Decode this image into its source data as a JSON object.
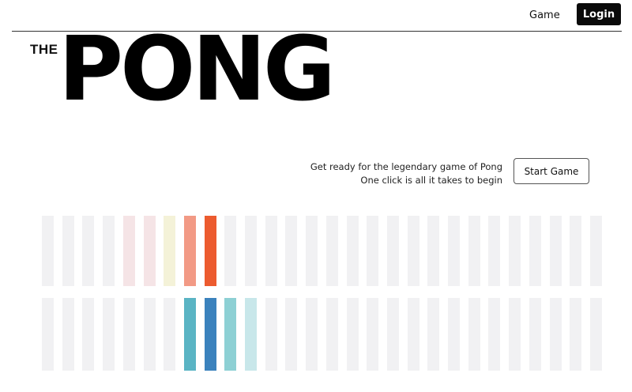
{
  "nav": {
    "game_label": "Game",
    "login_label": "Login"
  },
  "logo": {
    "small_text": "THE",
    "big_text": "PONG"
  },
  "hero": {
    "tagline_line1": "Get ready for the legendary game of Pong",
    "tagline_line2": "One click is all it takes to begin",
    "start_label": "Start Game"
  },
  "colors": {
    "bar_default": "#f1f1f3",
    "top_row": [
      "#f1f1f3",
      "#f1f1f3",
      "#f1f1f3",
      "#f1f1f3",
      "#f5e4e6",
      "#f5e4e6",
      "#f4f2d8",
      "#f29a85",
      "#ec5b2f",
      "#f1f1f3",
      "#f1f1f3",
      "#f1f1f3",
      "#f1f1f3",
      "#f1f1f3",
      "#f1f1f3",
      "#f1f1f3",
      "#f1f1f3",
      "#f1f1f3",
      "#f1f1f3",
      "#f1f1f3",
      "#f1f1f3",
      "#f1f1f3",
      "#f1f1f3",
      "#f1f1f3",
      "#f1f1f3",
      "#f1f1f3",
      "#f1f1f3",
      "#f1f1f3"
    ],
    "bottom_row": [
      "#f1f1f3",
      "#f1f1f3",
      "#f1f1f3",
      "#f1f1f3",
      "#f1f1f3",
      "#f1f1f3",
      "#f1f1f3",
      "#5ab4c4",
      "#3b82bd",
      "#8dd0d4",
      "#c8e7ea",
      "#f1f1f3",
      "#f1f1f3",
      "#f1f1f3",
      "#f1f1f3",
      "#f1f1f3",
      "#f1f1f3",
      "#f1f1f3",
      "#f1f1f3",
      "#f1f1f3",
      "#f1f1f3",
      "#f1f1f3",
      "#f1f1f3",
      "#f1f1f3",
      "#f1f1f3",
      "#f1f1f3",
      "#f1f1f3",
      "#f1f1f3"
    ]
  }
}
